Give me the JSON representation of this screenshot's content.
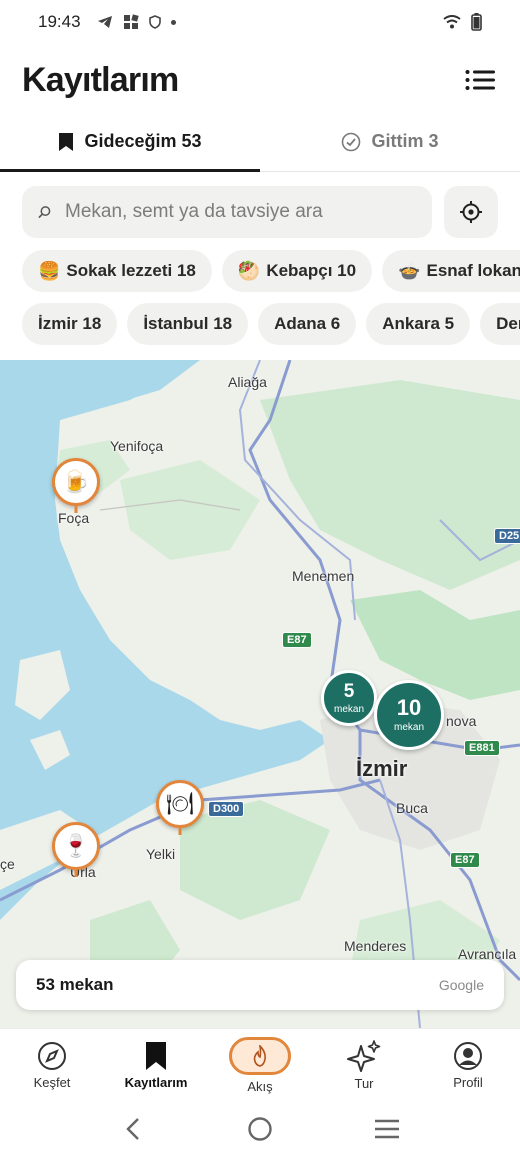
{
  "status_bar": {
    "time": "19:43"
  },
  "header": {
    "title": "Kayıtlarım"
  },
  "tabs": [
    {
      "label": "Gideceğim 53",
      "active": true
    },
    {
      "label": "Gittim 3",
      "active": false
    }
  ],
  "search": {
    "placeholder": "Mekan, semt ya da tavsiye ara",
    "value": ""
  },
  "category_chips": [
    {
      "emoji": "🍔",
      "label": "Sokak lezzeti 18"
    },
    {
      "emoji": "🥙",
      "label": "Kebapçı 10"
    },
    {
      "emoji": "🍲",
      "label": "Esnaf lokanta"
    }
  ],
  "city_chips": [
    {
      "label": "İzmir 18"
    },
    {
      "label": "İstanbul 18"
    },
    {
      "label": "Adana 6"
    },
    {
      "label": "Ankara 5"
    },
    {
      "label": "Den"
    }
  ],
  "map": {
    "labels": {
      "aliaga": "Aliağa",
      "yenifoca": "Yenifoça",
      "foca": "Foça",
      "menemen": "Menemen",
      "izmir": "İzmir",
      "buca": "Buca",
      "yelki": "Yelki",
      "urla": "Urla",
      "menderes": "Menderes",
      "avrancila": "Avrancıla",
      "nova": "nova",
      "ce": "çe"
    },
    "shields": {
      "e87_north": "E87",
      "e87_south": "E87",
      "e881": "E881",
      "d300": "D300",
      "d25": "D25"
    },
    "pins": [
      {
        "icon": "beer-icon",
        "glyph": "🍺"
      },
      {
        "icon": "plate-icon",
        "glyph": "🍽"
      },
      {
        "icon": "wine-icon",
        "glyph": "🍷"
      }
    ],
    "clusters": [
      {
        "count": "5",
        "unit": "mekan"
      },
      {
        "count": "10",
        "unit": "mekan"
      }
    ],
    "footer": {
      "count_text": "53 mekan",
      "attribution": "Google"
    }
  },
  "bottom_nav": [
    {
      "label": "Keşfet",
      "icon": "compass-icon"
    },
    {
      "label": "Kayıtlarım",
      "icon": "bookmark-icon",
      "active": true
    },
    {
      "label": "Akış",
      "icon": "flame-icon"
    },
    {
      "label": "Tur",
      "icon": "sparkle-icon"
    },
    {
      "label": "Profil",
      "icon": "profile-icon"
    }
  ],
  "colors": {
    "accent": "#e2863c",
    "cluster": "#1d6f63",
    "water": "#a8d8ea",
    "land": "#eef0ea",
    "green": "#bfe4c4"
  }
}
